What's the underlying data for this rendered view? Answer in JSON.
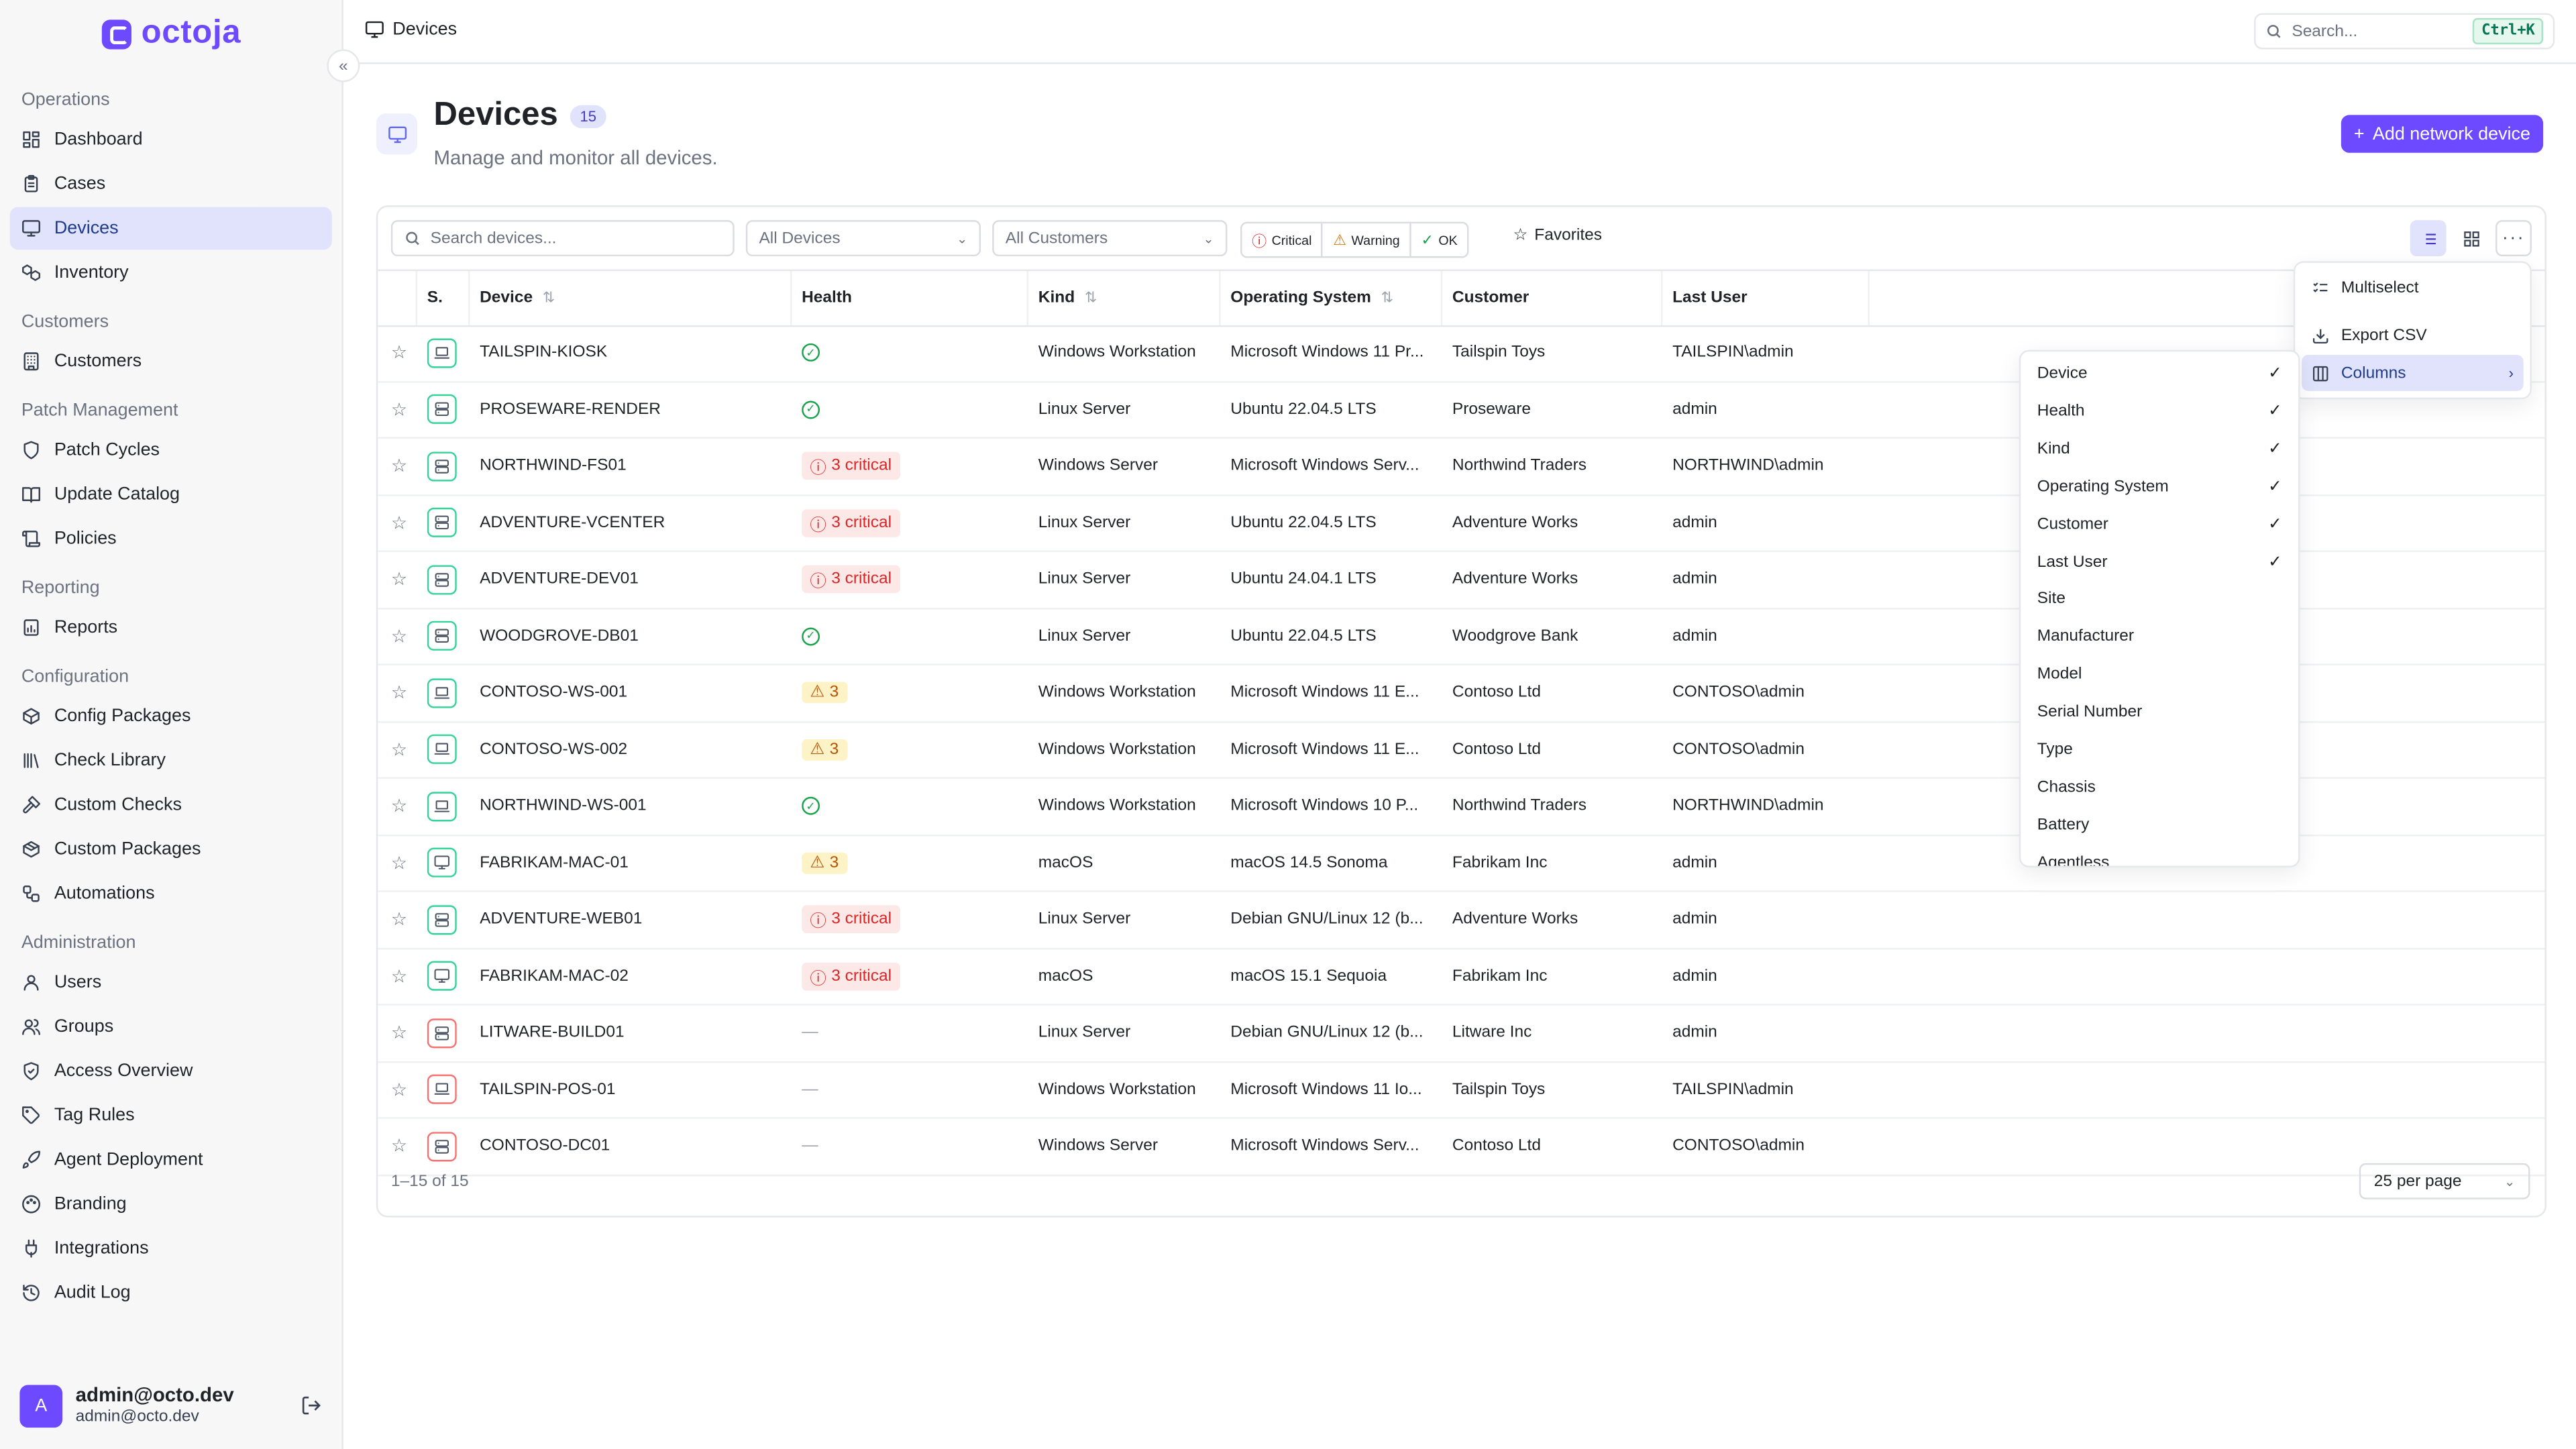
{
  "app": {
    "name": "octoja"
  },
  "sidebar": {
    "sections": [
      {
        "title": "Operations",
        "items": [
          {
            "label": "Dashboard",
            "icon": "dashboard-icon",
            "active": false
          },
          {
            "label": "Cases",
            "icon": "clipboard-icon",
            "active": false
          },
          {
            "label": "Devices",
            "icon": "monitor-icon",
            "active": true
          },
          {
            "label": "Inventory",
            "icon": "boxes-icon",
            "active": false
          }
        ]
      },
      {
        "title": "Customers",
        "items": [
          {
            "label": "Customers",
            "icon": "building-icon",
            "active": false
          }
        ]
      },
      {
        "title": "Patch Management",
        "items": [
          {
            "label": "Patch Cycles",
            "icon": "shield-icon",
            "active": false
          },
          {
            "label": "Update Catalog",
            "icon": "book-icon",
            "active": false
          },
          {
            "label": "Policies",
            "icon": "scroll-icon",
            "active": false
          }
        ]
      },
      {
        "title": "Reporting",
        "items": [
          {
            "label": "Reports",
            "icon": "report-icon",
            "active": false
          }
        ]
      },
      {
        "title": "Configuration",
        "items": [
          {
            "label": "Config Packages",
            "icon": "package-icon",
            "active": false
          },
          {
            "label": "Check Library",
            "icon": "library-icon",
            "active": false
          },
          {
            "label": "Custom Checks",
            "icon": "hammer-icon",
            "active": false
          },
          {
            "label": "Custom Packages",
            "icon": "packages-icon",
            "active": false
          },
          {
            "label": "Automations",
            "icon": "workflow-icon",
            "active": false
          }
        ]
      },
      {
        "title": "Administration",
        "items": [
          {
            "label": "Users",
            "icon": "user-icon",
            "active": false
          },
          {
            "label": "Groups",
            "icon": "users-icon",
            "active": false
          },
          {
            "label": "Access Overview",
            "icon": "shield-check-icon",
            "active": false
          },
          {
            "label": "Tag Rules",
            "icon": "tag-icon",
            "active": false
          },
          {
            "label": "Agent Deployment",
            "icon": "rocket-icon",
            "active": false
          },
          {
            "label": "Branding",
            "icon": "palette-icon",
            "active": false
          },
          {
            "label": "Integrations",
            "icon": "plug-icon",
            "active": false
          },
          {
            "label": "Audit Log",
            "icon": "history-icon",
            "active": false
          }
        ]
      }
    ],
    "user": {
      "initial": "A",
      "name": "admin@octo.dev",
      "email": "admin@octo.dev"
    }
  },
  "topbar": {
    "breadcrumb": "Devices",
    "search_placeholder": "Search...",
    "shortcut": "Ctrl+K"
  },
  "page": {
    "title": "Devices",
    "count": "15",
    "subtitle": "Manage and monitor all devices.",
    "add_button": "Add network device"
  },
  "filters": {
    "search_placeholder": "Search devices...",
    "device_filter": "All Devices",
    "customer_filter": "All Customers",
    "health": [
      "Critical",
      "Warning",
      "OK"
    ],
    "favorites": "Favorites"
  },
  "table": {
    "columns": [
      "S.",
      "Device",
      "Health",
      "Kind",
      "Operating System",
      "Customer",
      "Last User"
    ],
    "rows": [
      {
        "device": "TAILSPIN-KIOSK",
        "icon": "laptop",
        "status": "green",
        "health_type": "ok",
        "health_label": "",
        "kind": "Windows Workstation",
        "os": "Microsoft Windows 11 Pr...",
        "customer": "Tailspin Toys",
        "last_user": "TAILSPIN\\admin"
      },
      {
        "device": "PROSEWARE-RENDER",
        "icon": "server",
        "status": "green",
        "health_type": "ok",
        "health_label": "",
        "kind": "Linux Server",
        "os": "Ubuntu 22.04.5 LTS",
        "customer": "Proseware",
        "last_user": "admin"
      },
      {
        "device": "NORTHWIND-FS01",
        "icon": "server",
        "status": "green",
        "health_type": "critical",
        "health_label": "3 critical",
        "kind": "Windows Server",
        "os": "Microsoft Windows Serv...",
        "customer": "Northwind Traders",
        "last_user": "NORTHWIND\\admin"
      },
      {
        "device": "ADVENTURE-VCENTER",
        "icon": "server",
        "status": "green",
        "health_type": "critical",
        "health_label": "3 critical",
        "kind": "Linux Server",
        "os": "Ubuntu 22.04.5 LTS",
        "customer": "Adventure Works",
        "last_user": "admin"
      },
      {
        "device": "ADVENTURE-DEV01",
        "icon": "server",
        "status": "green",
        "health_type": "critical",
        "health_label": "3 critical",
        "kind": "Linux Server",
        "os": "Ubuntu 24.04.1 LTS",
        "customer": "Adventure Works",
        "last_user": "admin"
      },
      {
        "device": "WOODGROVE-DB01",
        "icon": "server",
        "status": "green",
        "health_type": "ok",
        "health_label": "",
        "kind": "Linux Server",
        "os": "Ubuntu 22.04.5 LTS",
        "customer": "Woodgrove Bank",
        "last_user": "admin"
      },
      {
        "device": "CONTOSO-WS-001",
        "icon": "laptop",
        "status": "green",
        "health_type": "warning",
        "health_label": "3",
        "kind": "Windows Workstation",
        "os": "Microsoft Windows 11 E...",
        "customer": "Contoso Ltd",
        "last_user": "CONTOSO\\admin"
      },
      {
        "device": "CONTOSO-WS-002",
        "icon": "laptop",
        "status": "green",
        "health_type": "warning",
        "health_label": "3",
        "kind": "Windows Workstation",
        "os": "Microsoft Windows 11 E...",
        "customer": "Contoso Ltd",
        "last_user": "CONTOSO\\admin"
      },
      {
        "device": "NORTHWIND-WS-001",
        "icon": "laptop",
        "status": "green",
        "health_type": "ok",
        "health_label": "",
        "kind": "Windows Workstation",
        "os": "Microsoft Windows 10 P...",
        "customer": "Northwind Traders",
        "last_user": "NORTHWIND\\admin"
      },
      {
        "device": "FABRIKAM-MAC-01",
        "icon": "monitor",
        "status": "green",
        "health_type": "warning",
        "health_label": "3",
        "kind": "macOS",
        "os": "macOS 14.5 Sonoma",
        "customer": "Fabrikam Inc",
        "last_user": "admin"
      },
      {
        "device": "ADVENTURE-WEB01",
        "icon": "server",
        "status": "green",
        "health_type": "critical",
        "health_label": "3 critical",
        "kind": "Linux Server",
        "os": "Debian GNU/Linux 12 (b...",
        "customer": "Adventure Works",
        "last_user": "admin"
      },
      {
        "device": "FABRIKAM-MAC-02",
        "icon": "monitor",
        "status": "green",
        "health_type": "critical",
        "health_label": "3 critical",
        "kind": "macOS",
        "os": "macOS 15.1 Sequoia",
        "customer": "Fabrikam Inc",
        "last_user": "admin"
      },
      {
        "device": "LITWARE-BUILD01",
        "icon": "server",
        "status": "red",
        "health_type": "none",
        "health_label": "—",
        "kind": "Linux Server",
        "os": "Debian GNU/Linux 12 (b...",
        "customer": "Litware Inc",
        "last_user": "admin"
      },
      {
        "device": "TAILSPIN-POS-01",
        "icon": "laptop",
        "status": "red",
        "health_type": "none",
        "health_label": "—",
        "kind": "Windows Workstation",
        "os": "Microsoft Windows 11 Io...",
        "customer": "Tailspin Toys",
        "last_user": "TAILSPIN\\admin"
      },
      {
        "device": "CONTOSO-DC01",
        "icon": "server",
        "status": "red",
        "health_type": "none",
        "health_label": "—",
        "kind": "Windows Server",
        "os": "Microsoft Windows Serv...",
        "customer": "Contoso Ltd",
        "last_user": "CONTOSO\\admin"
      }
    ],
    "pagination": {
      "summary": "1–15 of 15",
      "per_page": "25 per page"
    }
  },
  "actions_menu": {
    "items": [
      {
        "label": "Multiselect",
        "icon": "list-check-icon"
      },
      {
        "label": "Export CSV",
        "icon": "download-icon"
      },
      {
        "label": "Columns",
        "icon": "columns-icon"
      }
    ]
  },
  "columns_menu": {
    "items": [
      {
        "label": "Device",
        "checked": true
      },
      {
        "label": "Health",
        "checked": true
      },
      {
        "label": "Kind",
        "checked": true
      },
      {
        "label": "Operating System",
        "checked": true
      },
      {
        "label": "Customer",
        "checked": true
      },
      {
        "label": "Last User",
        "checked": true
      },
      {
        "label": "Site",
        "checked": false
      },
      {
        "label": "Manufacturer",
        "checked": false
      },
      {
        "label": "Model",
        "checked": false
      },
      {
        "label": "Serial Number",
        "checked": false
      },
      {
        "label": "Type",
        "checked": false
      },
      {
        "label": "Chassis",
        "checked": false
      },
      {
        "label": "Battery",
        "checked": false
      },
      {
        "label": "Agentless",
        "checked": false
      }
    ]
  },
  "colors": {
    "accent": "#6d4aff",
    "active_bg": "#e0e3fb",
    "critical": "#dc2626",
    "warning": "#b45309",
    "ok": "#16a34a",
    "status_ok_border": "#34d399",
    "status_bad_border": "#f87171"
  }
}
